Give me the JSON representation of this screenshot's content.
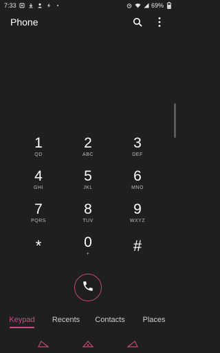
{
  "status_bar": {
    "time": "7:33",
    "battery": "69%",
    "left_icons": [
      "notification-icon",
      "download-icon",
      "person-icon",
      "bolt-icon",
      "dot-icon"
    ],
    "right_icons": [
      "alarm-icon",
      "wifi-icon",
      "signal-icon",
      "battery-icon"
    ]
  },
  "app_bar": {
    "title": "Phone",
    "icons": [
      "search-icon",
      "more-vertical-icon"
    ]
  },
  "keypad": {
    "rows": [
      [
        {
          "digit": "1",
          "letters": "QD"
        },
        {
          "digit": "2",
          "letters": "ABC"
        },
        {
          "digit": "3",
          "letters": "DEF"
        }
      ],
      [
        {
          "digit": "4",
          "letters": "GHI"
        },
        {
          "digit": "5",
          "letters": "JKL"
        },
        {
          "digit": "6",
          "letters": "MNO"
        }
      ],
      [
        {
          "digit": "7",
          "letters": "PQRS"
        },
        {
          "digit": "8",
          "letters": "TUV"
        },
        {
          "digit": "9",
          "letters": "WXYZ"
        }
      ],
      [
        {
          "digit": "*",
          "letters": ""
        },
        {
          "digit": "0",
          "letters": "+"
        },
        {
          "digit": "#",
          "letters": ""
        }
      ]
    ]
  },
  "call_button": {
    "icon": "phone-icon",
    "accent_color": "#c24a7a"
  },
  "tabs": [
    {
      "label": "Keypad",
      "active": true
    },
    {
      "label": "Recents",
      "active": false
    },
    {
      "label": "Contacts",
      "active": false
    },
    {
      "label": "Places",
      "active": false
    }
  ],
  "nav_bar": {
    "icons": [
      "back-icon",
      "home-icon",
      "recents-icon"
    ]
  },
  "colors": {
    "background": "#1f1f1f",
    "accent": "#d04a8a"
  }
}
